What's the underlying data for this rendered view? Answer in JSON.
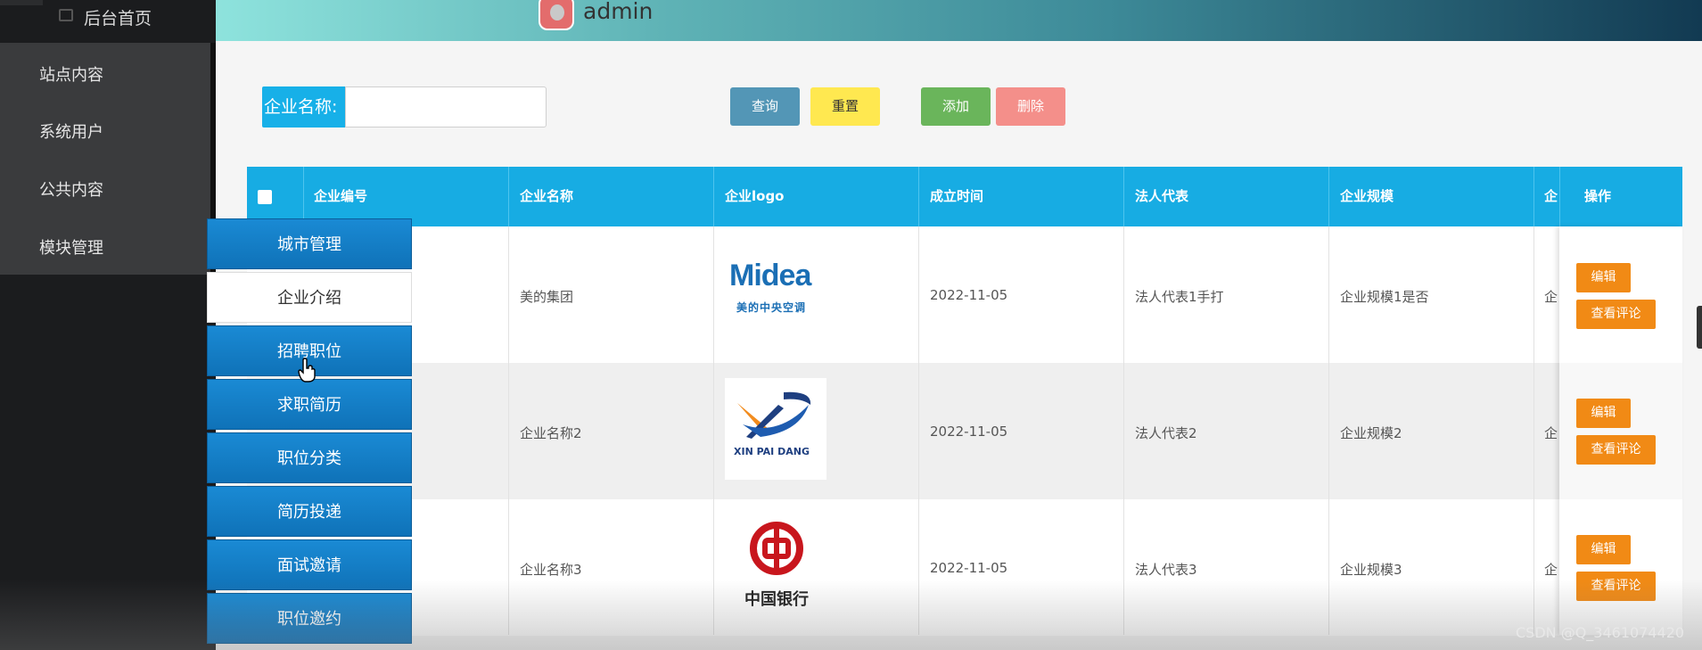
{
  "sidebar": {
    "home_label": "后台首页",
    "items": [
      {
        "label": "站点内容"
      },
      {
        "label": "系统用户"
      },
      {
        "label": "公共内容"
      },
      {
        "label": "模块管理"
      }
    ]
  },
  "submenu": {
    "items": [
      {
        "label": "城市管理"
      },
      {
        "label": "企业介绍"
      },
      {
        "label": "招聘职位"
      },
      {
        "label": "求职简历"
      },
      {
        "label": "职位分类"
      },
      {
        "label": "简历投递"
      },
      {
        "label": "面试邀请"
      },
      {
        "label": "职位邀约"
      }
    ],
    "active_index": 1
  },
  "header": {
    "username": "admin"
  },
  "search": {
    "label": "企业名称:",
    "value": ""
  },
  "toolbar": {
    "query_label": "查询",
    "reset_label": "重置",
    "add_label": "添加",
    "delete_label": "删除"
  },
  "table": {
    "headers": [
      "企业编号",
      "企业名称",
      "企业logo",
      "成立时间",
      "法人代表",
      "企业规模",
      "企",
      "操作"
    ],
    "rows": [
      {
        "name": "美的集团",
        "logo": "midea-logo",
        "date": "2022-11-05",
        "rep": "法人代表1手打",
        "scale": "企业规模1是否",
        "cut": "企"
      },
      {
        "name": "企业名称2",
        "logo": "xinpaidang-logo",
        "date": "2022-11-05",
        "rep": "法人代表2",
        "scale": "企业规模2",
        "cut": "企"
      },
      {
        "name": "企业名称3",
        "logo": "bank-of-china-logo",
        "date": "2022-11-05",
        "rep": "法人代表3",
        "scale": "企业规模3",
        "cut": "企"
      }
    ],
    "edit_label": "编辑",
    "comments_label": "查看评论"
  },
  "logos": {
    "midea_word": "Midea",
    "midea_sub": "美的中央空调",
    "xpd_text": "XIN PAI DANG",
    "boc_text": "中国银行"
  },
  "watermark": "CSDN @Q_3461074420"
}
